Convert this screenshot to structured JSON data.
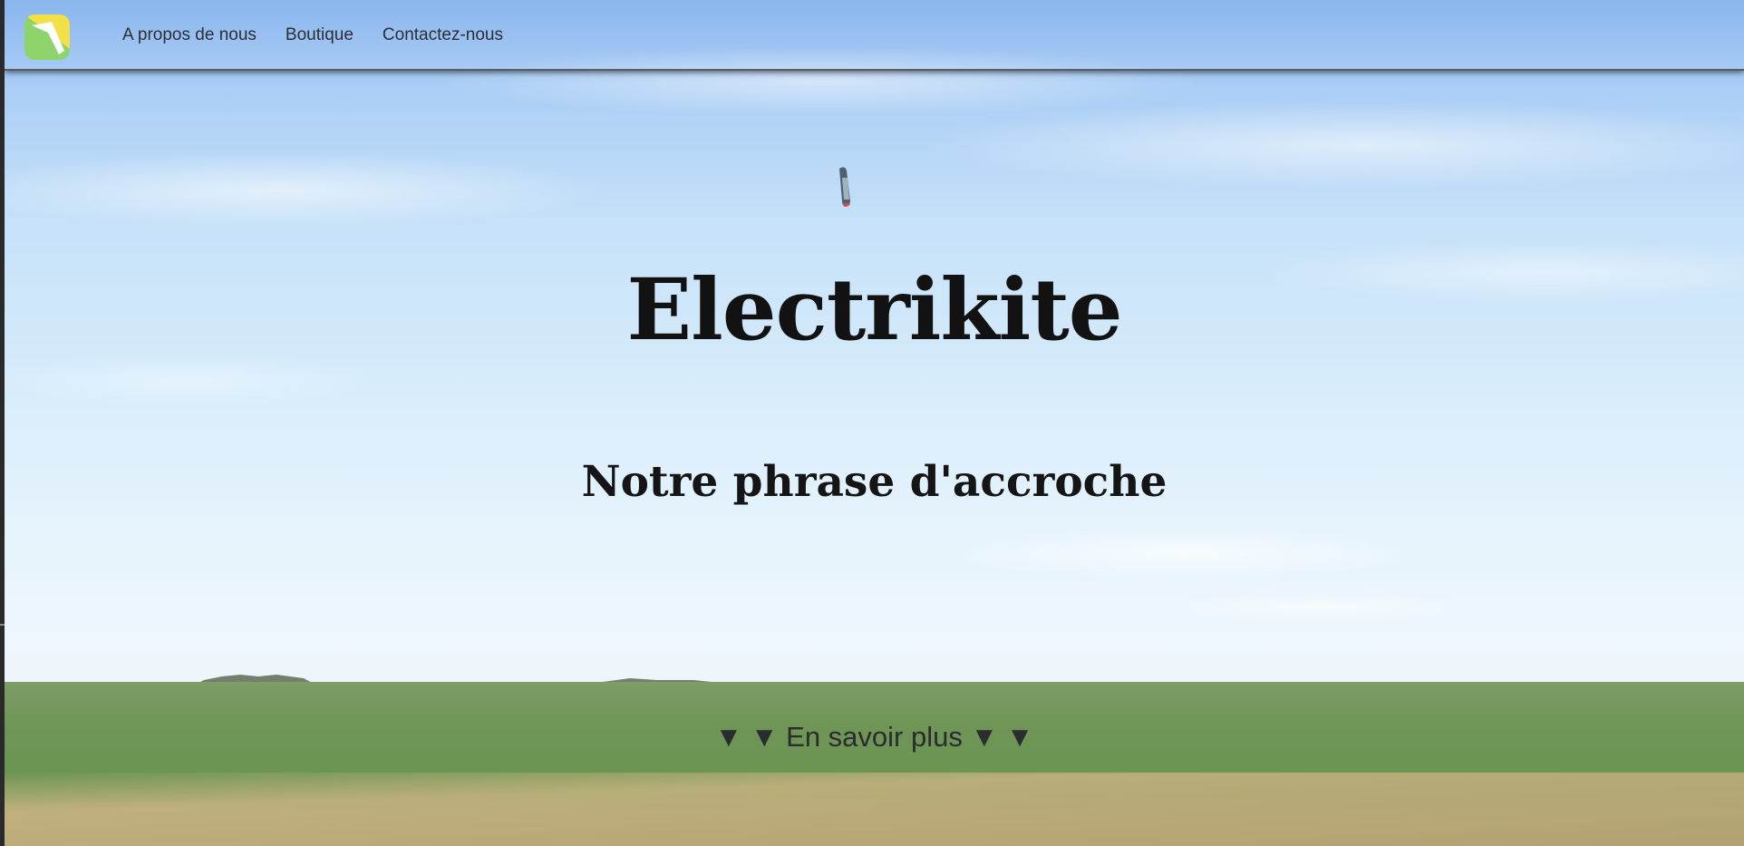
{
  "nav": {
    "logo_icon": "kite-logo-icon",
    "links": [
      {
        "label": "A propos de nous"
      },
      {
        "label": "Boutique"
      },
      {
        "label": "Contactez-nous"
      }
    ]
  },
  "hero": {
    "title": "Electrikite",
    "subtitle": "Notre phrase d'accroche",
    "cta": "▼ ▼ En savoir plus ▼ ▼"
  },
  "colors": {
    "logo_green": "#8fd36b",
    "logo_yellow": "#f3df48",
    "title_text": "#121212"
  }
}
